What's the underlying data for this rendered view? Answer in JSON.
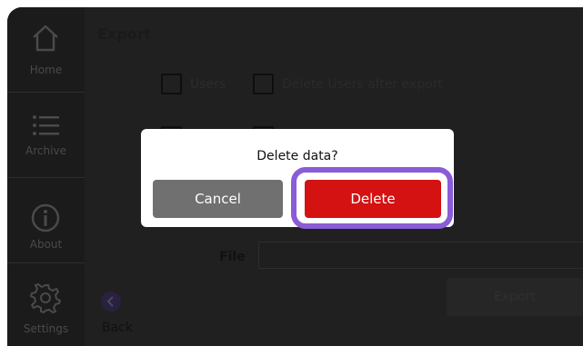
{
  "sidebar": {
    "items": [
      {
        "label": "Home",
        "icon": "home-icon"
      },
      {
        "label": "Archive",
        "icon": "list-icon"
      },
      {
        "label": "About",
        "icon": "info-icon"
      },
      {
        "label": "Settings",
        "icon": "gear-icon"
      }
    ]
  },
  "main": {
    "title": "Export",
    "options": [
      {
        "label": "Users",
        "checked": false
      },
      {
        "label": "Delete Users after export",
        "checked": false
      }
    ],
    "file_label": "File",
    "file_value": "",
    "export_label": "Export",
    "back_label": "Back"
  },
  "dialog": {
    "title": "Delete data?",
    "cancel_label": "Cancel",
    "delete_label": "Delete"
  },
  "colors": {
    "delete": "#d41212",
    "cancel": "#707070",
    "highlight": "#8a5cd6"
  }
}
